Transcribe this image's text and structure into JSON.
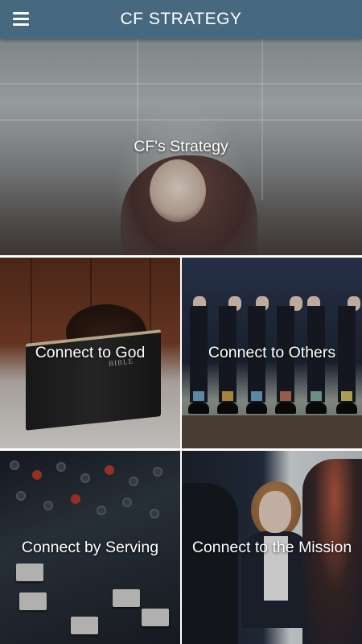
{
  "app": {
    "title": "CF STRATEGY",
    "menu_icon": "hamburger-menu-icon",
    "bar_color": "#46697f"
  },
  "hero": {
    "label": "CF's Strategy"
  },
  "tiles": [
    {
      "label": "Connect to God",
      "photo_text": "BIBLE"
    },
    {
      "label": "Connect to Others"
    },
    {
      "label": "Connect by Serving"
    },
    {
      "label": "Connect to the Mission"
    }
  ]
}
